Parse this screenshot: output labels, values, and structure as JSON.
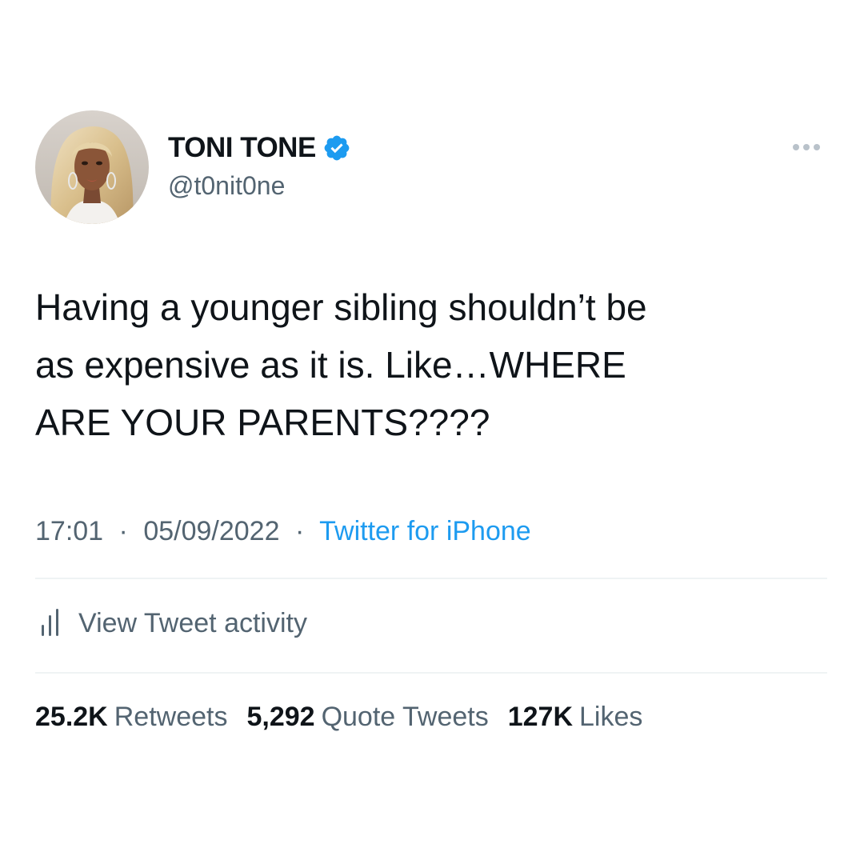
{
  "author": {
    "display_name": "TONI TONE",
    "handle": "@t0nit0ne",
    "verified": true,
    "avatar": "profile-photo"
  },
  "tweet": {
    "text": "Having a younger sibling shouldn’t be\nas expensive as it is. Like…WHERE\nARE YOUR PARENTS????",
    "time": "17:01",
    "separator": "·",
    "date": "05/09/2022",
    "source": "Twitter for iPhone"
  },
  "activity": {
    "label": "View Tweet activity",
    "icon": "bar-chart-icon"
  },
  "stats": {
    "retweets_count": "25.2K",
    "retweets_label": "Retweets",
    "quotes_count": "5,292",
    "quotes_label": "Quote Tweets",
    "likes_count": "127K",
    "likes_label": "Likes"
  },
  "icons": {
    "verified": "verified-badge-icon",
    "more": "more-options-icon"
  },
  "colors": {
    "accent": "#1d9bf0",
    "text_primary": "#0f1419",
    "text_secondary": "#536471",
    "divider": "#eff3f4",
    "background": "#ffffff"
  }
}
